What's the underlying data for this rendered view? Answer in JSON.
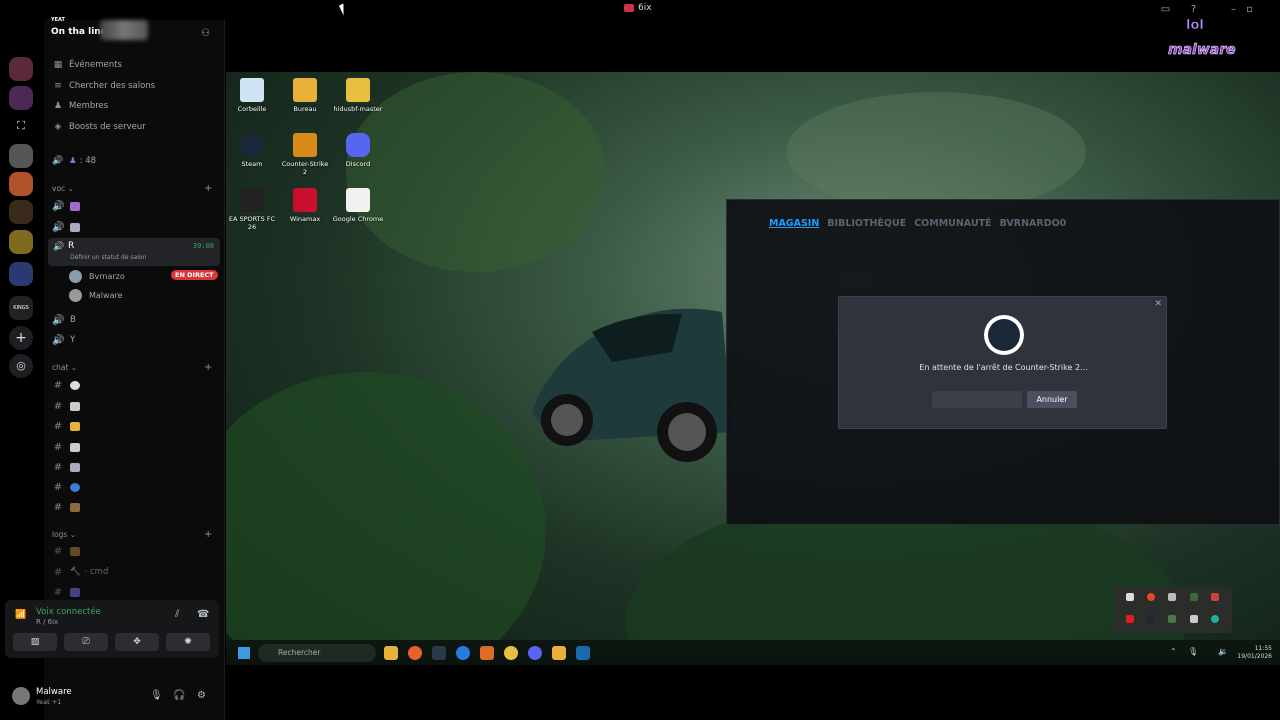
{
  "window": {
    "title": "6ix"
  },
  "server": {
    "tag": "YEAT",
    "name": "On tha line"
  },
  "menu": [
    {
      "label": "Événements",
      "icon": "calendar-icon"
    },
    {
      "label": "Chercher des salons",
      "icon": "search-icon"
    },
    {
      "label": "Membres",
      "icon": "members-icon"
    },
    {
      "label": "Boosts de serveur",
      "icon": "boost-icon"
    }
  ],
  "member_count": ": 48",
  "categories": {
    "voc": "voc",
    "chat": "chat",
    "logs": "logs"
  },
  "voice_channels": [
    {
      "label": "R",
      "status": "Définir un statut de salon",
      "timer": "39:08"
    },
    {
      "label": "B"
    },
    {
      "label": "Y"
    }
  ],
  "members": [
    {
      "name": "Bvrnarzo",
      "badge": "EN DIRECT"
    },
    {
      "name": "Malware"
    }
  ],
  "log_channel": "· cmd",
  "voice_panel": {
    "status": "Voix connectée",
    "channel": "R / 6ix"
  },
  "user": {
    "name": "Malware",
    "status": "Yeat +1"
  },
  "desktop_icons": [
    {
      "label": "Corbeille",
      "color": "#cfe3f2"
    },
    {
      "label": "Bureau",
      "color": "#e8b23a"
    },
    {
      "label": "hidusbf-master",
      "color": "#e8c040"
    },
    {
      "label": "Steam",
      "color": "#1b2838"
    },
    {
      "label": "Counter-Strike 2",
      "color": "#d88a1a"
    },
    {
      "label": "Discord",
      "color": "#5865f2"
    },
    {
      "label": "EA SPORTS FC 26",
      "color": "#222222"
    },
    {
      "label": "Winamax",
      "color": "#c8102e"
    },
    {
      "label": "Google Chrome",
      "color": "#f1f1f1"
    }
  ],
  "steam": {
    "tabs": [
      "MAGASIN",
      "BIBLIOTHÈQUE",
      "COMMUNAUTÉ",
      "BVRNARDO0"
    ],
    "dialog_message": "En attente de l'arrêt de Counter-Strike 2...",
    "cancel_label": "Annuler"
  },
  "taskbar": {
    "search_placeholder": "Rechercher",
    "time": "11:55",
    "date": "19/01/2026"
  },
  "watermark": {
    "line1": "lol",
    "line2": "malware"
  }
}
